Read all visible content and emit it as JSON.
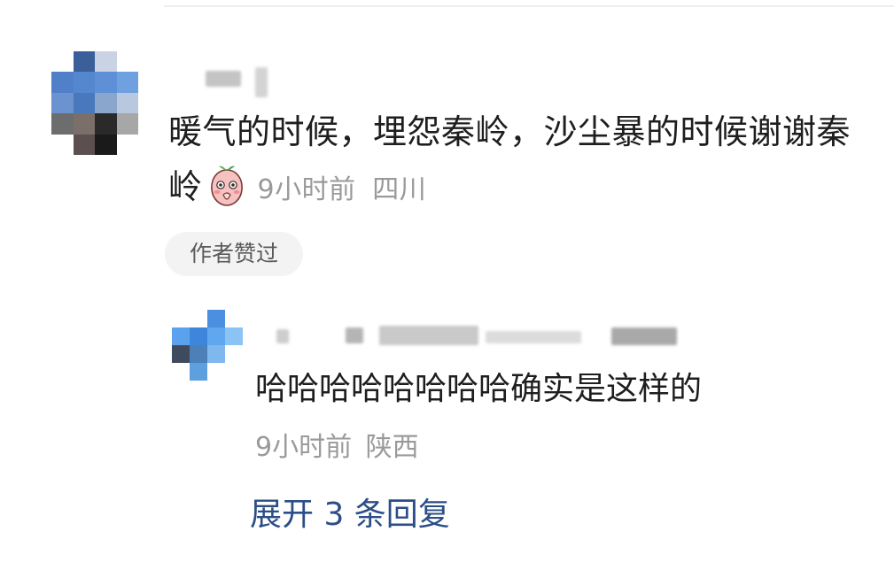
{
  "comment": {
    "text": "暖气的时候，埋怨秦岭，沙尘暴的时候谢谢秦岭",
    "emoji_icon": "peach-shy-emoji-icon",
    "time": "9小时前",
    "location": "四川",
    "author_like_badge": "作者赞过"
  },
  "reply": {
    "text": "哈哈哈哈哈哈哈哈确实是这样的",
    "time": "9小时前",
    "location": "陕西"
  },
  "expand_replies_label": "展开 3 条回复",
  "colors": {
    "text": "#1e1e1e",
    "meta": "#9a9a9a",
    "link": "#2b4e86",
    "badge_bg": "#f3f3f3"
  }
}
